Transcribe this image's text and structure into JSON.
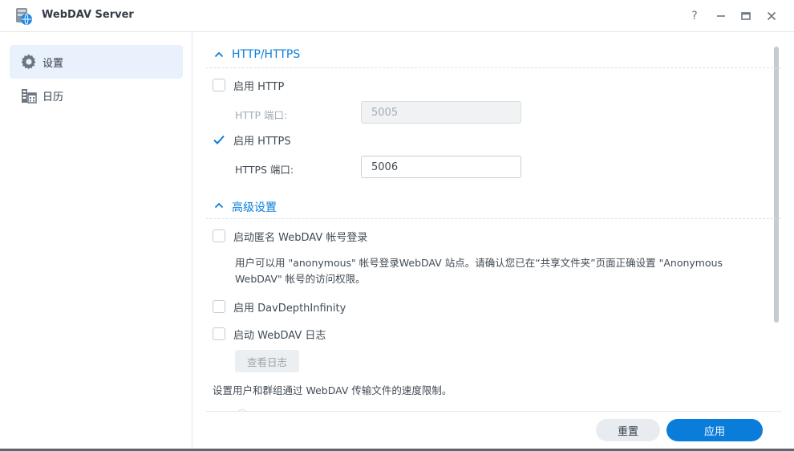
{
  "window": {
    "title": "WebDAV Server",
    "controls": {
      "help": "?",
      "minimize": "—",
      "maximize": "▭",
      "close": "✕"
    }
  },
  "sidebar": {
    "items": [
      {
        "label": "设置",
        "icon": "gear-icon",
        "active": true
      },
      {
        "label": "日历",
        "icon": "calendar-building-icon",
        "active": false
      }
    ]
  },
  "sections": {
    "http": {
      "title": "HTTP/HTTPS",
      "enable_http": {
        "label": "启用 HTTP",
        "checked": false
      },
      "http_port": {
        "label": "HTTP 端口:",
        "value": "5005",
        "disabled": true
      },
      "enable_https": {
        "label": "启用 HTTPS",
        "checked": true
      },
      "https_port": {
        "label": "HTTPS 端口:",
        "value": "5006",
        "disabled": false
      }
    },
    "advanced": {
      "title": "高级设置",
      "anonymous": {
        "label": "启动匿名 WebDAV 帐号登录",
        "checked": false,
        "description": "用户可以用 \"anonymous\" 帐号登录WebDAV 站点。请确认您已在“共享文件夹”页面正确设置 \"Anonymous WebDAV\" 帐号的访问权限。"
      },
      "dav_depth": {
        "label": "启用 DavDepthInfinity",
        "checked": false
      },
      "log": {
        "label": "启动 WebDAV 日志",
        "checked": false
      },
      "view_log_button": "查看日志",
      "speed_limit_text": "设置用户和群组通过 WebDAV 传输文件的速度限制。"
    }
  },
  "footer": {
    "reset_label": "重置",
    "apply_label": "应用"
  },
  "colors": {
    "accent": "#0a7ddb",
    "active_bg": "#e9f2fc"
  }
}
